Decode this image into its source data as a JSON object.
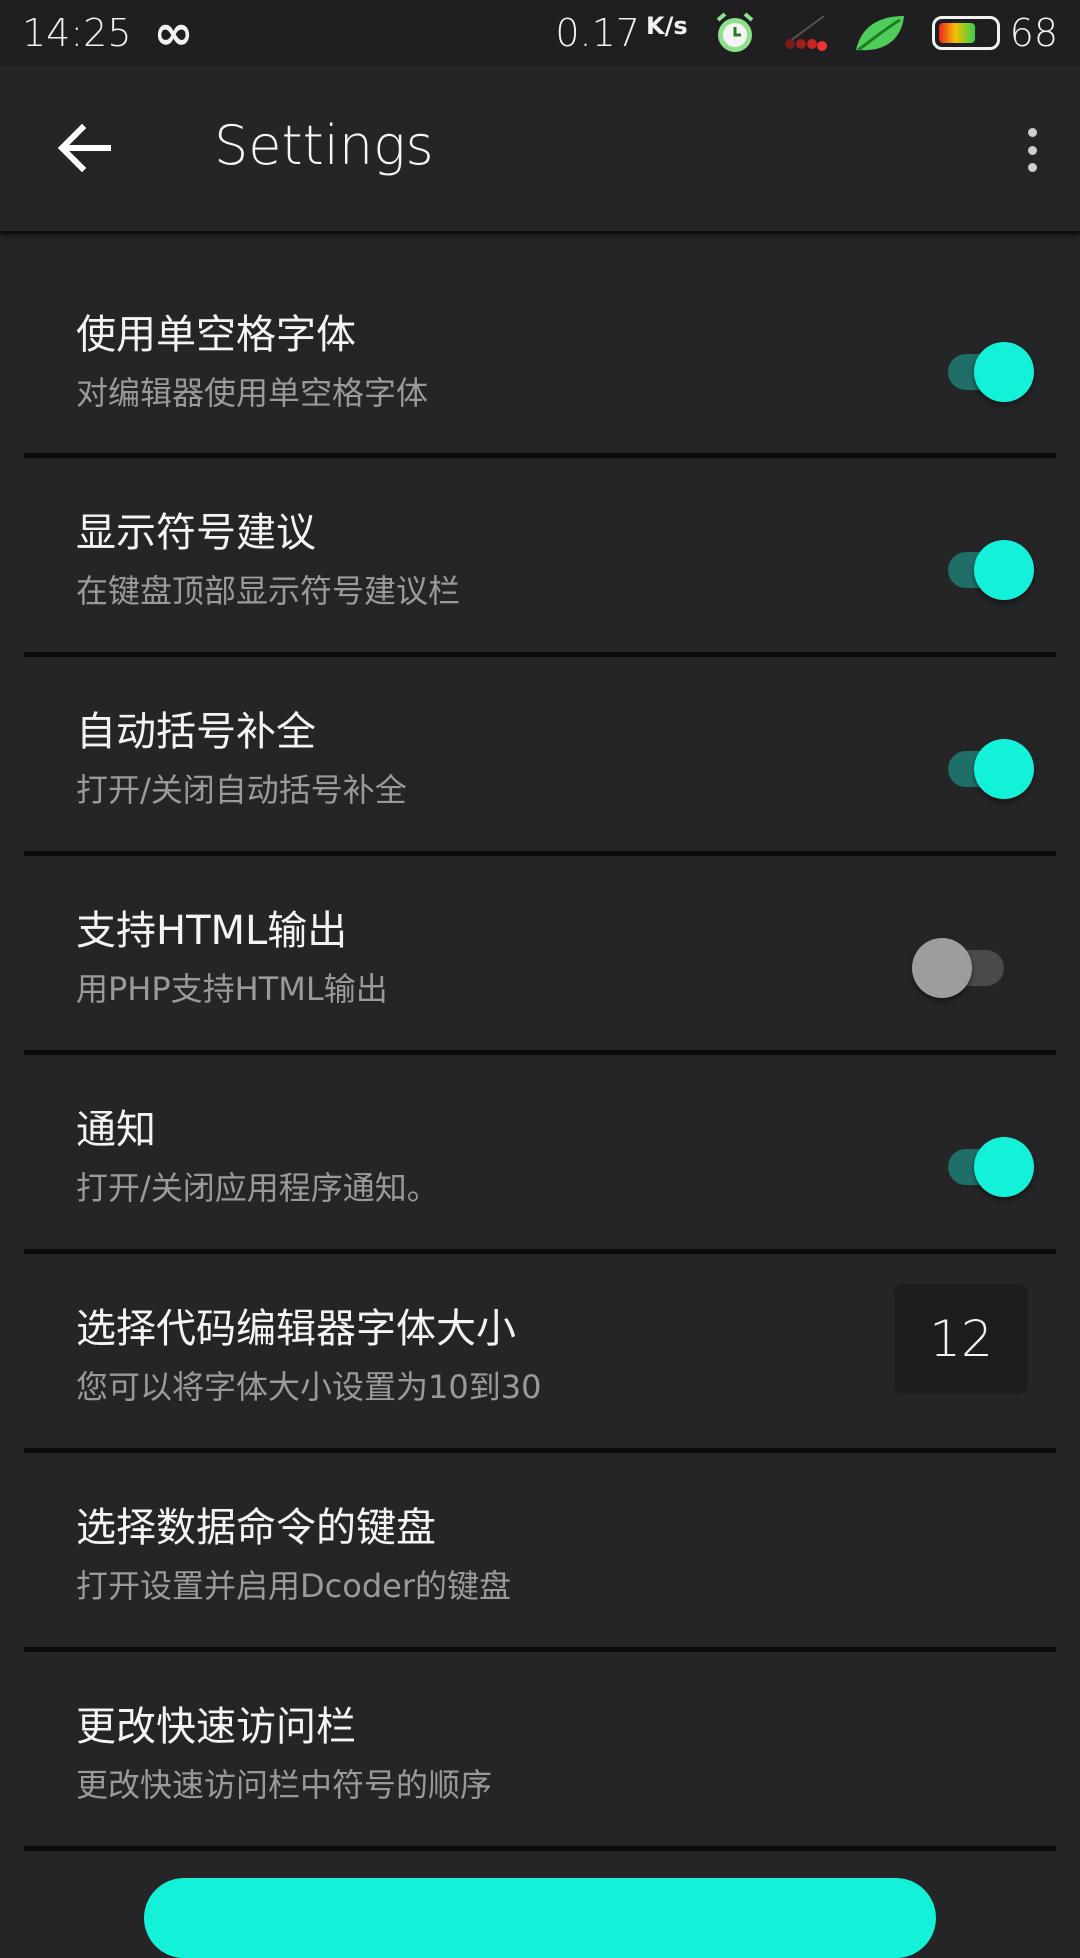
{
  "status_bar": {
    "time": "14:25",
    "net_speed": "0.17",
    "net_speed_unit": "K/s",
    "battery_level": "68",
    "battery_fraction": 0.68
  },
  "app_bar": {
    "title": "Settings"
  },
  "settings": [
    {
      "title": "使用单空格字体",
      "subtitle": "对编辑器使用单空格字体",
      "control": "toggle",
      "on": true
    },
    {
      "title": "显示符号建议",
      "subtitle": "在键盘顶部显示符号建议栏",
      "control": "toggle",
      "on": true
    },
    {
      "title": "自动括号补全",
      "subtitle": "打开/关闭自动括号补全",
      "control": "toggle",
      "on": true
    },
    {
      "title": "支持HTML输出",
      "subtitle": "用PHP支持HTML输出",
      "control": "toggle",
      "on": false
    },
    {
      "title": "通知",
      "subtitle": "打开/关闭应用程序通知。",
      "control": "toggle",
      "on": true
    },
    {
      "title": "选择代码编辑器字体大小",
      "subtitle": "您可以将字体大小设置为10到30",
      "control": "value",
      "value": "12"
    },
    {
      "title": "选择数据命令的键盘",
      "subtitle": "打开设置并启用Dcoder的键盘",
      "control": "none"
    },
    {
      "title": "更改快速访问栏",
      "subtitle": "更改快速访问栏中符号的顺序",
      "control": "none"
    }
  ],
  "colors": {
    "accent": "#13f1d9",
    "track_on": "#1f6f68",
    "background": "#252527"
  }
}
